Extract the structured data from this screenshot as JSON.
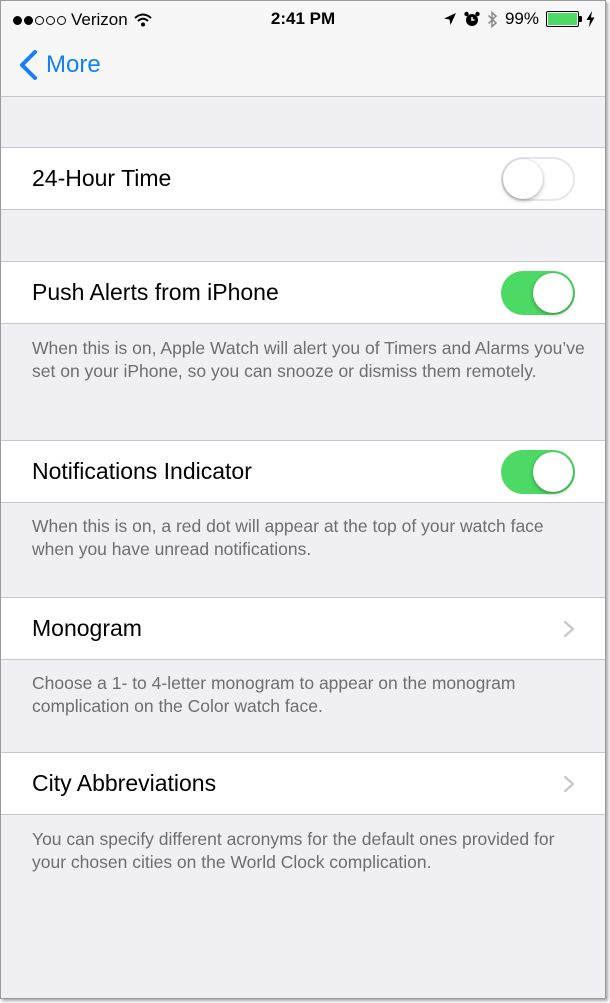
{
  "status_bar": {
    "carrier": "Verizon",
    "time": "2:41 PM",
    "battery": "99%",
    "signal_bars_filled": 2,
    "signal_bars_total": 5
  },
  "nav": {
    "back_label": "More"
  },
  "settings": {
    "hour_24": {
      "label": "24-Hour Time",
      "enabled": false
    },
    "push_alerts": {
      "label": "Push Alerts from iPhone",
      "enabled": true,
      "footer": "When this is on, Apple Watch will alert you of Timers and Alarms you’ve set on your iPhone, so you can snooze or dismiss them remotely."
    },
    "notifications_indicator": {
      "label": "Notifications Indicator",
      "enabled": true,
      "footer": "When this is on, a red dot will appear at the top of your watch face when you have unread notifications."
    },
    "monogram": {
      "label": "Monogram",
      "footer": "Choose a 1- to 4-letter monogram to appear on the monogram complication on the Color watch face."
    },
    "city_abbreviations": {
      "label": "City Abbreviations",
      "footer": "You can specify different acronyms for the default ones provided for your chosen cities on the World Clock complication."
    }
  },
  "colors": {
    "accent": "#157efb",
    "toggle_on": "#4cd964",
    "battery": "#4cd964",
    "grouped_background": "#efeff4",
    "footer_text": "#6d6d72"
  },
  "icons": [
    "wifi-icon",
    "location-arrow-icon",
    "alarm-clock-icon",
    "bluetooth-icon",
    "battery-icon",
    "charging-bolt-icon",
    "chevron-left-icon",
    "chevron-right-icon"
  ]
}
